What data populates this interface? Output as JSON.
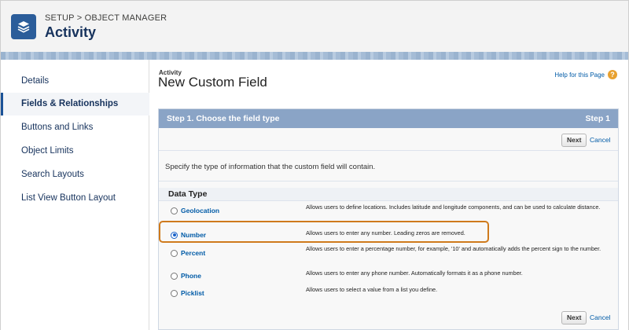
{
  "header": {
    "breadcrumb": "SETUP > OBJECT MANAGER",
    "title": "Activity",
    "icon": "layers-icon"
  },
  "sidebar": {
    "items": [
      {
        "label": "Details",
        "active": false
      },
      {
        "label": "Fields & Relationships",
        "active": true
      },
      {
        "label": "Buttons and Links",
        "active": false
      },
      {
        "label": "Object Limits",
        "active": false
      },
      {
        "label": "Search Layouts",
        "active": false
      },
      {
        "label": "List View Button Layout",
        "active": false
      }
    ]
  },
  "main": {
    "object_label": "Activity",
    "page_title": "New Custom Field",
    "help_link": "Help for this Page",
    "step_title": "Step 1. Choose the field type",
    "step_number": "Step 1",
    "next_label": "Next",
    "cancel_label": "Cancel",
    "instruction": "Specify the type of information that the custom field will contain.",
    "data_type_heading": "Data Type",
    "options": [
      {
        "label": "Geolocation",
        "selected": false,
        "description": "Allows users to define locations. Includes latitude and longitude components, and can be used to calculate distance."
      },
      {
        "label": "Number",
        "selected": true,
        "description": "Allows users to enter any number. Leading zeros are removed."
      },
      {
        "label": "Percent",
        "selected": false,
        "description": "Allows users to enter a percentage number, for example, '10' and automatically adds the percent sign to the number."
      },
      {
        "label": "Phone",
        "selected": false,
        "description": "Allows users to enter any phone number. Automatically formats it as a phone number."
      },
      {
        "label": "Picklist",
        "selected": false,
        "description": "Allows users to select a value from a list you define."
      }
    ]
  },
  "colors": {
    "step_bar": "#8aa4c6",
    "highlight": "#cf7a1c",
    "link": "#015ba7"
  }
}
